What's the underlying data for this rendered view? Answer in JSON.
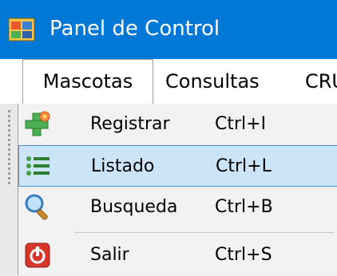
{
  "window": {
    "title": "Panel de Control",
    "title_bar_color": "#0078d7",
    "icon": "app-window-icon"
  },
  "menubar": {
    "items": [
      {
        "label": "Mascotas",
        "open": true
      },
      {
        "label": "Consultas",
        "open": false
      },
      {
        "label": "CRU",
        "open": false
      }
    ]
  },
  "dropdown": {
    "items": [
      {
        "label": "Registrar",
        "shortcut": "Ctrl+I",
        "icon": "add-icon",
        "selected": false
      },
      {
        "label": "Listado",
        "shortcut": "Ctrl+L",
        "icon": "list-icon",
        "selected": true
      },
      {
        "label": "Busqueda",
        "shortcut": "Ctrl+B",
        "icon": "search-icon",
        "selected": false
      },
      {
        "label": "Salir",
        "shortcut": "Ctrl+S",
        "icon": "exit-icon",
        "selected": false
      }
    ],
    "highlight_color": "#cce4f7"
  }
}
